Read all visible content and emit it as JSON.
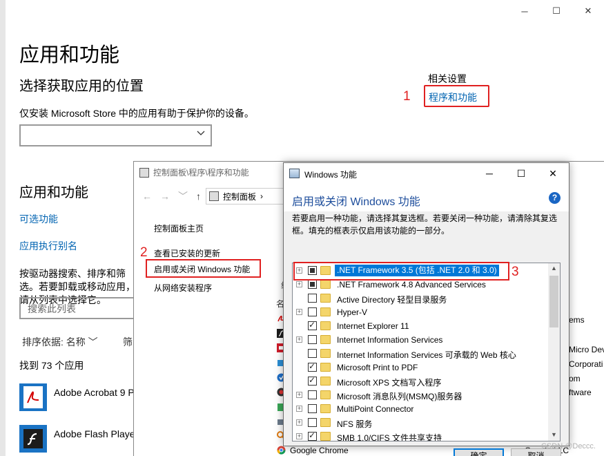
{
  "settings": {
    "caption": {
      "minimize": "─",
      "maximize": "☐",
      "close": "✕"
    },
    "title": "应用和功能",
    "install_section_title": "选择获取应用的位置",
    "install_note": "仅安装 Microsoft Store 中的应用有助于保护你的设备。",
    "related_title": "相关设置",
    "related_link": "程序和功能",
    "annotation_1": "1",
    "apps_section_title": "应用和功能",
    "optional_features_link": "可选功能",
    "app_alias_link": "应用执行别名",
    "search_desc": "按驱动器搜索、排序和筛选。若要卸载或移动应用，请从列表中选择它。",
    "search_placeholder": "搜索此列表",
    "sort_label": "排序依据: 名称 ﹀",
    "filter_label": "筛",
    "found_count": "找到 73 个应用",
    "apps": [
      {
        "name": "Adobe Acrobat 9 P",
        "color": "#ffffff"
      },
      {
        "name": "Adobe Flash Player",
        "color": "#1c1c1c"
      }
    ]
  },
  "control_panel": {
    "title": "控制面板\\程序\\程序和功能",
    "nav": {
      "back": "←",
      "forward": "→",
      "recent": "﹀",
      "up": "↑"
    },
    "address": "控制面板",
    "address_sep": "›",
    "links": {
      "home": "控制面板主页",
      "installed_updates": "查看已安装的更新",
      "windows_features": "启用或关闭 Windows 功能",
      "install_from_network": "从网络安装程序"
    },
    "annotation_2": "2",
    "column_org": "组",
    "column_name": "名",
    "right_texts": [
      "ems",
      "Micro Dev",
      "Corporati",
      "om",
      "ftware"
    ],
    "bottom_left": "Google Chrome",
    "bottom_right": "Google LLC"
  },
  "features_dialog": {
    "title": "Windows 功能",
    "caption": {
      "minimize": "─",
      "maximize": "☐",
      "close": "✕"
    },
    "heading": "启用或关闭 Windows 功能",
    "help": "?",
    "description": "若要启用一种功能，请选择其复选框。若要关闭一种功能，请清除其复选框。填充的框表示仅启用该功能的一部分。",
    "annotation_3": "3",
    "features": [
      {
        "label": ".NET Framework 3.5 (包括 .NET 2.0 和 3.0)",
        "state": "partial",
        "expandable": true,
        "selected": true
      },
      {
        "label": ".NET Framework 4.8 Advanced Services",
        "state": "partial",
        "expandable": true,
        "selected": false
      },
      {
        "label": "Active Directory 轻型目录服务",
        "state": "unchecked",
        "expandable": false,
        "selected": false
      },
      {
        "label": "Hyper-V",
        "state": "unchecked",
        "expandable": true,
        "selected": false
      },
      {
        "label": "Internet Explorer 11",
        "state": "checked",
        "expandable": false,
        "selected": false
      },
      {
        "label": "Internet Information Services",
        "state": "unchecked",
        "expandable": true,
        "selected": false
      },
      {
        "label": "Internet Information Services 可承载的 Web 核心",
        "state": "unchecked",
        "expandable": false,
        "selected": false
      },
      {
        "label": "Microsoft Print to PDF",
        "state": "checked",
        "expandable": false,
        "selected": false
      },
      {
        "label": "Microsoft XPS 文档写入程序",
        "state": "checked",
        "expandable": false,
        "selected": false
      },
      {
        "label": "Microsoft 消息队列(MSMQ)服务器",
        "state": "unchecked",
        "expandable": true,
        "selected": false
      },
      {
        "label": "MultiPoint Connector",
        "state": "unchecked",
        "expandable": true,
        "selected": false
      },
      {
        "label": "NFS 服务",
        "state": "unchecked",
        "expandable": true,
        "selected": false
      },
      {
        "label": "SMB 1.0/CIFS 文件共享支持",
        "state": "checked",
        "expandable": true,
        "selected": false
      }
    ],
    "ok_button": "确定",
    "cancel_button": "取消"
  },
  "watermark": "CSDN @Deccc.",
  "colors": {
    "link": "#0063b1",
    "annotation": "#e02020",
    "selection": "#0078d7",
    "dialog_heading": "#1e4e9c"
  }
}
